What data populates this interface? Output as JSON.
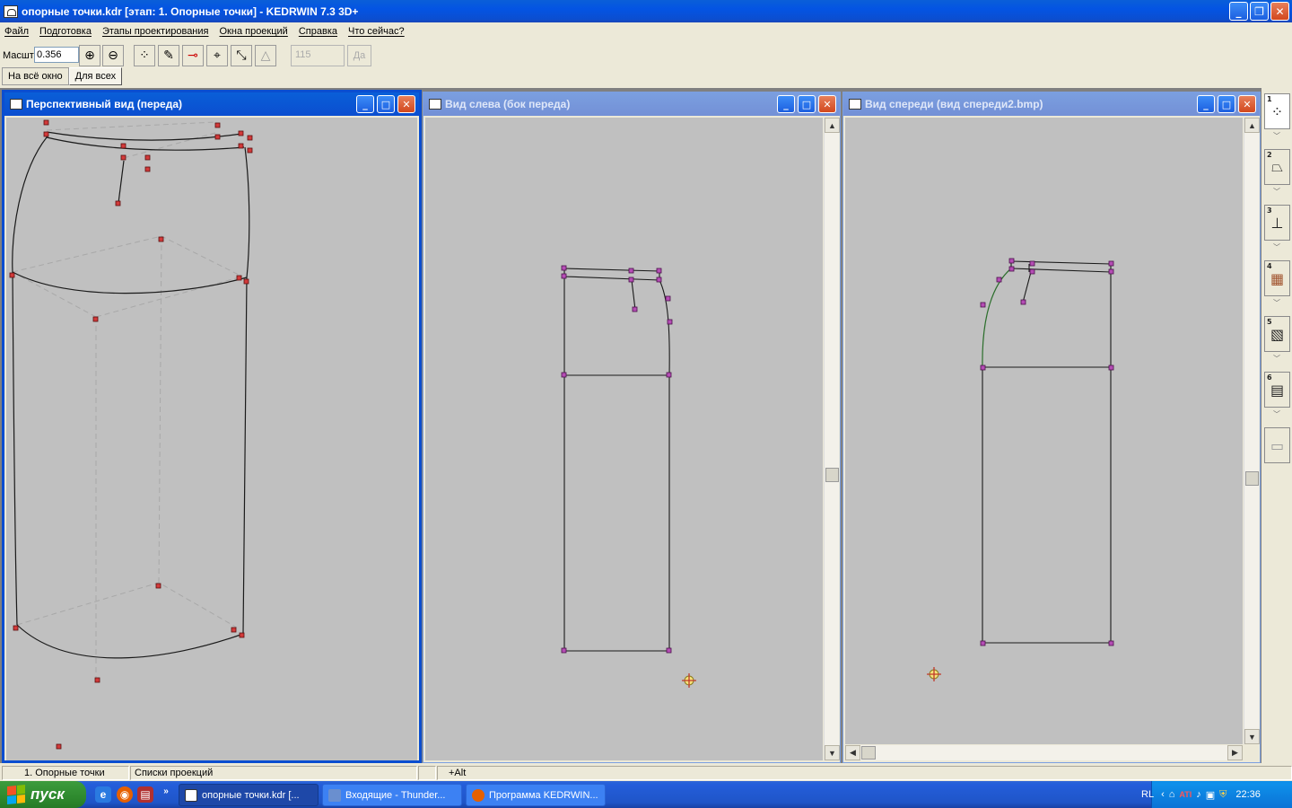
{
  "app": {
    "title": "опорные точки.kdr [этап: 1. Опорные точки] - KEDRWIN 7.3 3D+"
  },
  "menu": {
    "items": [
      "Файл",
      "Подготовка",
      "Этапы проектирования",
      "Окна проекций",
      "Справка",
      "Что сейчас?"
    ]
  },
  "toolbar": {
    "scale_label": "Масшт",
    "scale_value": "0.356",
    "num_value": "115",
    "da_label": "Да",
    "modes": [
      "На всё окно",
      "Для всех"
    ]
  },
  "windows": [
    {
      "title": "Перспективный вид (переда)",
      "active": true
    },
    {
      "title": "Вид слева (бок переда)",
      "active": false
    },
    {
      "title": "Вид спереди (вид спереди2.bmp)",
      "active": false
    }
  ],
  "status": {
    "stage": "1. Опорные точки",
    "lists": "Списки проекций",
    "modifier": "+Alt"
  },
  "taskbar": {
    "start": "пуск",
    "tasks": [
      "опорные точки.kdr [...",
      "Входящие - Thunder...",
      "Программа KEDRWIN..."
    ],
    "lang": "RL",
    "clock": "22:36"
  },
  "colors": {
    "accent": "#0b4ed0",
    "canvas": "#c0c0c0",
    "point_red": "#d23a3a",
    "point_magenta": "#b02fb0"
  }
}
